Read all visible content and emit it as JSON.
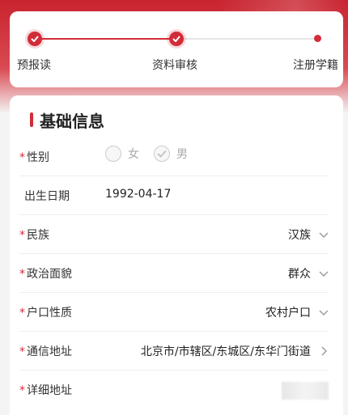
{
  "colors": {
    "accent": "#d12d39",
    "line_inactive": "#e5e5e5"
  },
  "steps": [
    {
      "label": "预报读",
      "state": "done"
    },
    {
      "label": "资料审核",
      "state": "current"
    },
    {
      "label": "注册学籍",
      "state": "pending"
    }
  ],
  "section": {
    "title": "基础信息"
  },
  "form": {
    "gender": {
      "label": "性别",
      "required_mark": "*",
      "options": [
        {
          "label": "女",
          "selected": false
        },
        {
          "label": "男",
          "selected": true
        }
      ]
    },
    "birth_date": {
      "label": "出生日期",
      "value": "1992-04-17"
    },
    "ethnicity": {
      "label": "民族",
      "required_mark": "*",
      "value": "汉族",
      "icon": "chevron-down-icon"
    },
    "political_status": {
      "label": "政治面貌",
      "required_mark": "*",
      "value": "群众",
      "icon": "chevron-down-icon"
    },
    "household_type": {
      "label": "户口性质",
      "required_mark": "*",
      "value": "农村户口",
      "icon": "chevron-down-icon"
    },
    "mailing_address": {
      "label": "通信地址",
      "required_mark": "*",
      "value": "北京市/市辖区/东城区/东华门街道",
      "icon": "chevron-right-icon"
    },
    "detail_address": {
      "label": "详细地址",
      "required_mark": "*",
      "value": ""
    }
  }
}
